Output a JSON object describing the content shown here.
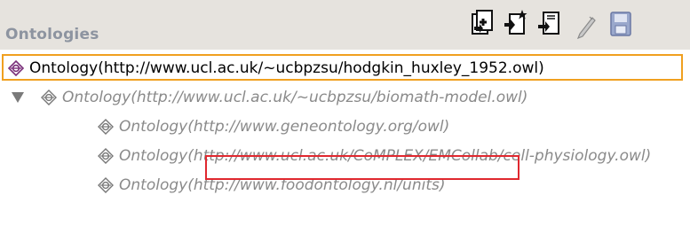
{
  "panel": {
    "title": "Ontologies"
  },
  "toolbar": {
    "buttons": [
      {
        "name": "add-import-icon"
      },
      {
        "name": "new-ontology-icon"
      },
      {
        "name": "import-file-icon"
      },
      {
        "name": "edit-pencil-icon"
      },
      {
        "name": "save-disk-icon"
      }
    ]
  },
  "tree": {
    "rows": [
      {
        "label": "Ontology(http://www.ucl.ac.uk/~ucbpzsu/hodgkin_huxley_1952.owl)",
        "selected": true
      },
      {
        "label": "Ontology(http://www.ucl.ac.uk/~ucbpzsu/biomath-model.owl)",
        "expanded": true
      },
      {
        "label": "Ontology(http://www.geneontology.org/owl)"
      },
      {
        "label": "Ontology(http://www.ucl.ac.uk/CoMPLEX/EMCollab/cell-physiology.owl)"
      },
      {
        "label": "Ontology(http://www.foodontology.nl/units)"
      }
    ]
  },
  "colors": {
    "header_bg": "#e6e3de",
    "selection_border": "#f0a020",
    "highlight_border": "#e0282f",
    "inferred_text": "#8a8a8a"
  }
}
